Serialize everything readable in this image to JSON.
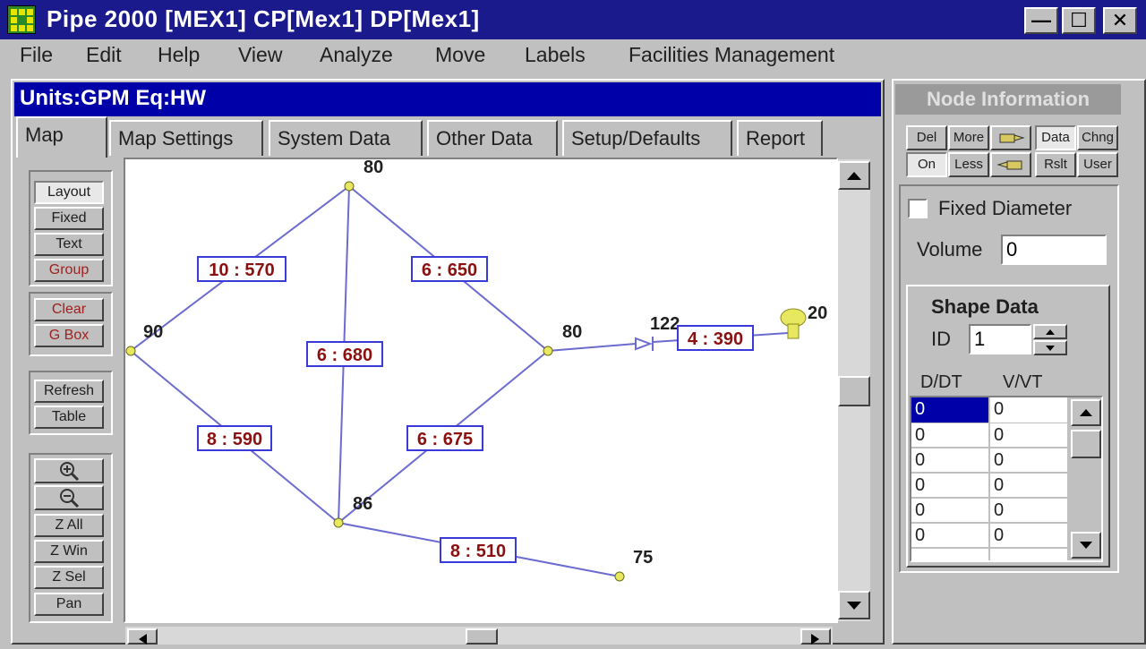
{
  "window": {
    "title": "Pipe 2000  [MEX1]  CP[Mex1]  DP[Mex1]",
    "minimize_label": "—",
    "maximize_label": "☐",
    "close_label": "✕"
  },
  "menu": [
    "File",
    "Edit",
    "Help",
    "View",
    "Analyze",
    "Move",
    "Labels",
    "Facilities Management"
  ],
  "units_bar": "Units:GPM  Eq:HW",
  "tabs": [
    "Map",
    "Map Settings",
    "System Data",
    "Other Data",
    "Setup/Defaults",
    "Report"
  ],
  "tools": {
    "group1": [
      "Layout",
      "Fixed",
      "Text",
      "Group"
    ],
    "group2": [
      "Clear",
      "G Box"
    ],
    "group3": [
      "Refresh",
      "Table"
    ],
    "group4": [
      "Z All",
      "Z Win",
      "Z Sel",
      "Pan"
    ]
  },
  "map": {
    "node_labels": [
      "80",
      "90",
      "80",
      "122",
      "20",
      "86",
      "75"
    ],
    "pipe_labels": [
      "10 : 570",
      "6 : 650",
      "6 : 680",
      "8 : 590",
      "6 : 675",
      "4 : 390",
      "8 : 510"
    ]
  },
  "node_panel": {
    "title": "Node Information",
    "buttons_row1": [
      "Del",
      "More",
      "Data",
      "Chng"
    ],
    "buttons_row2": [
      "On",
      "Less",
      "Rslt",
      "User"
    ],
    "fixed_diameter_label": "Fixed Diameter",
    "volume_label": "Volume",
    "volume_value": "0",
    "shape_data_title": "Shape Data",
    "id_label": "ID",
    "id_value": "1",
    "col_headers": [
      "D/DT",
      "V/VT"
    ],
    "rows": [
      [
        "0",
        "0"
      ],
      [
        "0",
        "0"
      ],
      [
        "0",
        "0"
      ],
      [
        "0",
        "0"
      ],
      [
        "0",
        "0"
      ],
      [
        "0",
        "0"
      ]
    ]
  },
  "colors": {
    "title_bar": "#1a1a8c",
    "units_bar": "#0000a8",
    "pipe": "#6b6bd0",
    "node": "#e8e860",
    "pipe_label_text": "#8b1010"
  }
}
